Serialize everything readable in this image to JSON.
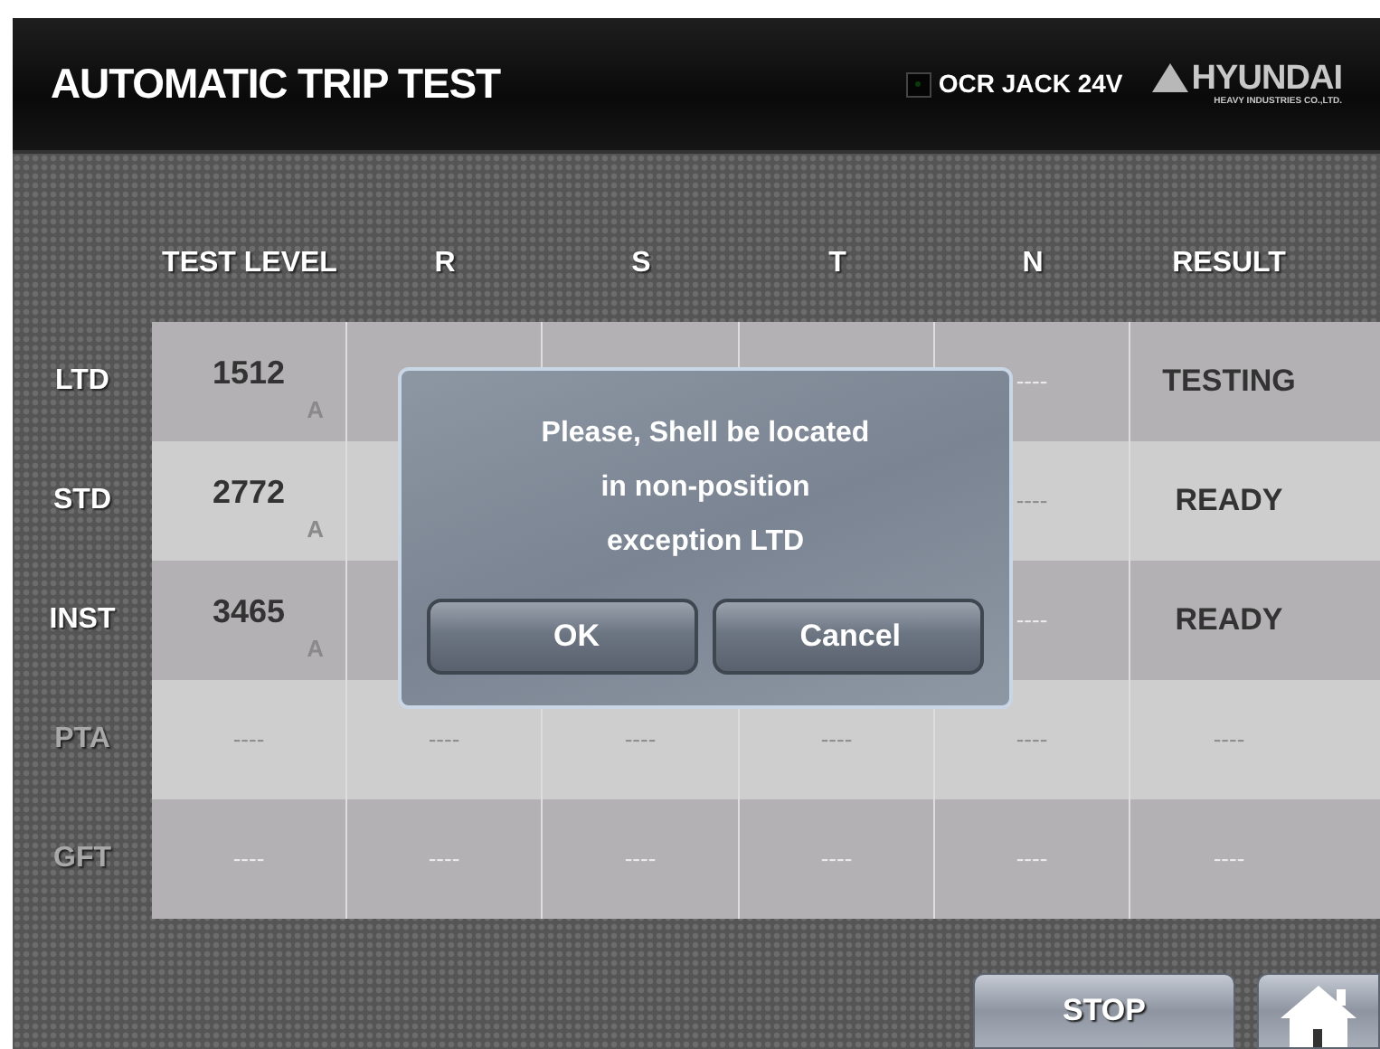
{
  "header": {
    "title": "AUTOMATIC TRIP TEST",
    "indicator": {
      "label": "OCR JACK 24V",
      "on": false
    },
    "logo": {
      "name": "HYUNDAI",
      "tagline": "HEAVY INDUSTRIES CO.,LTD."
    }
  },
  "table": {
    "columns": [
      "TEST LEVEL",
      "R",
      "S",
      "T",
      "N",
      "RESULT"
    ],
    "rows": [
      {
        "label": "LTD",
        "disabled": false,
        "test_level": {
          "value": "1512",
          "unit": "A"
        },
        "n": "----",
        "result": "TESTING"
      },
      {
        "label": "STD",
        "disabled": false,
        "test_level": {
          "value": "2772",
          "unit": "A"
        },
        "n": "----",
        "result": "READY"
      },
      {
        "label": "INST",
        "disabled": false,
        "test_level": {
          "value": "3465",
          "unit": "A"
        },
        "n": "----",
        "result": "READY"
      },
      {
        "label": "PTA",
        "disabled": true,
        "test_level": {
          "value": "----"
        },
        "r": "----",
        "s": "----",
        "t": "----",
        "n": "----",
        "result": "----"
      },
      {
        "label": "GFT",
        "disabled": true,
        "test_level": {
          "value": "----"
        },
        "r": "----",
        "s": "----",
        "t": "----",
        "n": "----",
        "result": "----"
      }
    ]
  },
  "dialog": {
    "message_lines": [
      "Please, Shell be located",
      "in non-position",
      "exception LTD"
    ],
    "buttons": [
      "OK",
      "Cancel"
    ]
  },
  "footer": {
    "buttons": [
      {
        "kind": "text",
        "label": "STOP"
      },
      {
        "kind": "home"
      }
    ]
  }
}
